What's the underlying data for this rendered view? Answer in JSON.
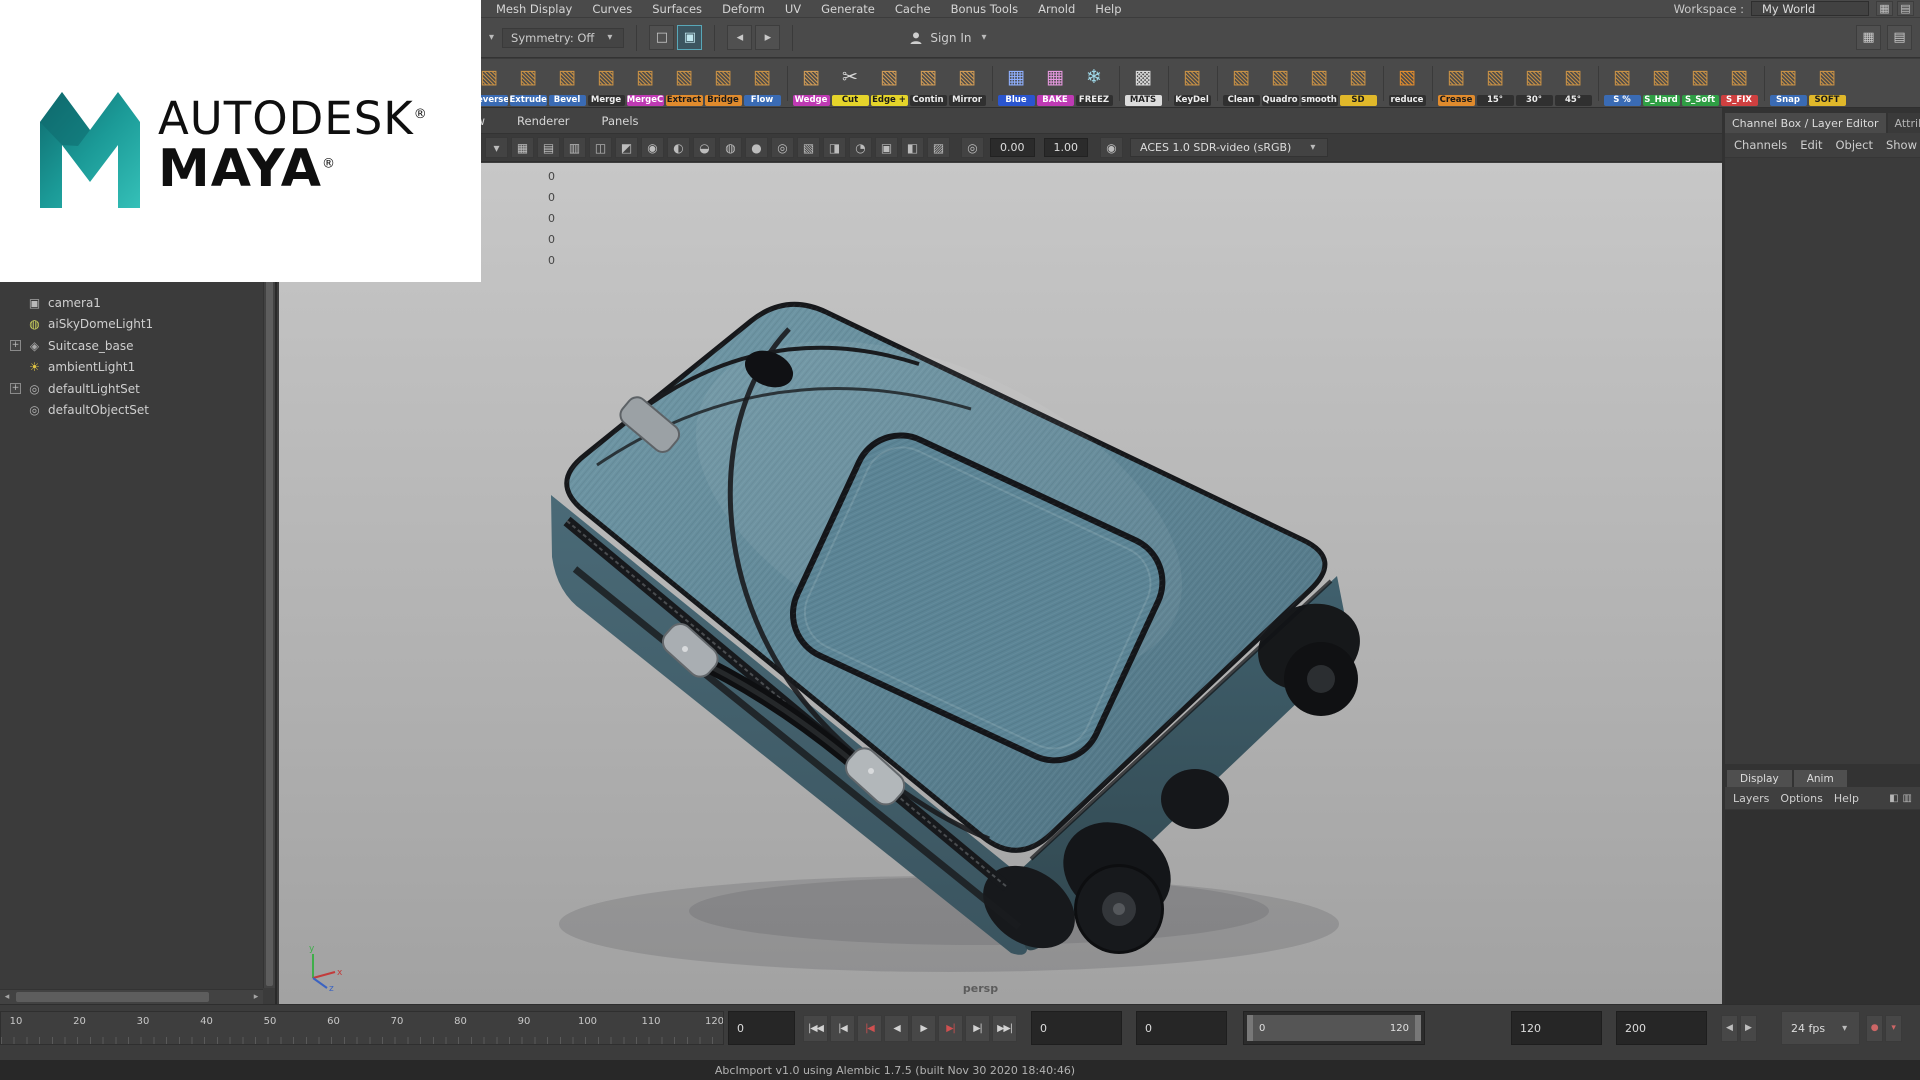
{
  "app": {
    "menu_items": [
      "Mesh Display",
      "Curves",
      "Surfaces",
      "Deform",
      "UV",
      "Generate",
      "Cache",
      "Bonus Tools",
      "Arnold",
      "Help"
    ],
    "workspace_label": "Workspace :",
    "workspace_value": "My World",
    "right_icons": [
      "▦",
      "▤"
    ]
  },
  "logo": {
    "brand": "AUTODESK",
    "product": "MAYA",
    "reg": "®"
  },
  "statusline": {
    "prefix_icon": "▾",
    "symmetry_label": "Symmetry: Off",
    "caret": "▾",
    "group_a": [
      {
        "glyph": "□",
        "active": false
      },
      {
        "glyph": "▣",
        "active": true
      }
    ],
    "group_b": [
      {
        "glyph": "◂",
        "active": false
      },
      {
        "glyph": "▸",
        "active": false
      }
    ],
    "sign_in_label": "Sign In",
    "right_icons": [
      "▦",
      "▤"
    ]
  },
  "shelf": {
    "items": [
      {
        "label": "Reverse",
        "bg": "#3a6bb4",
        "fg": "#ffffff",
        "glyph": "▧",
        "ic": "#c79045",
        "sep": false
      },
      {
        "label": "Extrude",
        "bg": "#3a6bb4",
        "fg": "#ffffff",
        "glyph": "▧",
        "ic": "#c79045",
        "sep": false
      },
      {
        "label": "Bevel",
        "bg": "#3a6bb4",
        "fg": "#ffffff",
        "glyph": "▧",
        "ic": "#c79045",
        "sep": false
      },
      {
        "label": "Merge",
        "bg": "#303030",
        "fg": "#eeeeee",
        "glyph": "▧",
        "ic": "#c79045",
        "sep": false
      },
      {
        "label": "MergeC",
        "bg": "#bf3ab4",
        "fg": "#ffffff",
        "glyph": "▧",
        "ic": "#c79045",
        "sep": false
      },
      {
        "label": "Extract",
        "bg": "#e08b2d",
        "fg": "#1a1a1a",
        "glyph": "▧",
        "ic": "#c79045",
        "sep": false
      },
      {
        "label": "Bridge",
        "bg": "#e08b2d",
        "fg": "#1a1a1a",
        "glyph": "▧",
        "ic": "#c79045",
        "sep": false
      },
      {
        "label": "Flow",
        "bg": "#3a6bb4",
        "fg": "#ffffff",
        "glyph": "▧",
        "ic": "#c79045",
        "sep": true
      },
      {
        "label": "Wedge",
        "bg": "#bf3ab4",
        "fg": "#ffffff",
        "glyph": "▧",
        "ic": "#cf9a55",
        "sep": false
      },
      {
        "label": "Cut",
        "bg": "#e5d42a",
        "fg": "#1a1a1a",
        "glyph": "✂",
        "ic": "#d8d8d8",
        "sep": false
      },
      {
        "label": "Edge +",
        "bg": "#e5d42a",
        "fg": "#1a1a1a",
        "glyph": "▧",
        "ic": "#cf9a55",
        "sep": false
      },
      {
        "label": "Contin",
        "bg": "#303030",
        "fg": "#eeeeee",
        "glyph": "▧",
        "ic": "#cf9a55",
        "sep": false
      },
      {
        "label": "Mirror",
        "bg": "#303030",
        "fg": "#eeeeee",
        "glyph": "▧",
        "ic": "#cf9a55",
        "sep": true
      },
      {
        "label": "Blue",
        "bg": "#2a55cf",
        "fg": "#ffffff",
        "glyph": "▦",
        "ic": "#8fb0ff",
        "sep": false
      },
      {
        "label": "BAKE",
        "bg": "#bf3ab4",
        "fg": "#ffffff",
        "glyph": "▦",
        "ic": "#e598de",
        "sep": false
      },
      {
        "label": "FREEZ",
        "bg": "#303030",
        "fg": "#eeeeee",
        "glyph": "❄",
        "ic": "#9fd8e8",
        "sep": true
      },
      {
        "label": "MATS",
        "bg": "#dcdcdc",
        "fg": "#222222",
        "glyph": "▩",
        "ic": "#d8d8d8",
        "sep": true
      },
      {
        "label": "KeyDel",
        "bg": "#303030",
        "fg": "#eeeeee",
        "glyph": "▧",
        "ic": "#c79045",
        "sep": true
      },
      {
        "label": "Clean",
        "bg": "#303030",
        "fg": "#eeeeee",
        "glyph": "▧",
        "ic": "#c79045",
        "sep": false
      },
      {
        "label": "Quadro",
        "bg": "#303030",
        "fg": "#eeeeee",
        "glyph": "▧",
        "ic": "#c79045",
        "sep": false
      },
      {
        "label": "smooth",
        "bg": "#303030",
        "fg": "#eeeeee",
        "glyph": "▧",
        "ic": "#c79045",
        "sep": false
      },
      {
        "label": "SD",
        "bg": "#e0b82a",
        "fg": "#1a1a1a",
        "glyph": "▧",
        "ic": "#c79045",
        "sep": true
      },
      {
        "label": "reduce",
        "bg": "#303030",
        "fg": "#eeeeee",
        "glyph": "▧",
        "ic": "#e08b2d",
        "sep": true
      },
      {
        "label": "Crease",
        "bg": "#e08b2d",
        "fg": "#1a1a1a",
        "glyph": "▧",
        "ic": "#c79045",
        "sep": false
      },
      {
        "label": "15°",
        "bg": "#303030",
        "fg": "#eeeeee",
        "glyph": "▧",
        "ic": "#c79045",
        "sep": false
      },
      {
        "label": "30°",
        "bg": "#303030",
        "fg": "#eeeeee",
        "glyph": "▧",
        "ic": "#c79045",
        "sep": false
      },
      {
        "label": "45°",
        "bg": "#303030",
        "fg": "#eeeeee",
        "glyph": "▧",
        "ic": "#c79045",
        "sep": true
      },
      {
        "label": "S %",
        "bg": "#3a6bb4",
        "fg": "#ffffff",
        "glyph": "▧",
        "ic": "#c79045",
        "sep": false
      },
      {
        "label": "S_Hard",
        "bg": "#2f9e44",
        "fg": "#ffffff",
        "glyph": "▧",
        "ic": "#c79045",
        "sep": false
      },
      {
        "label": "S_Soft",
        "bg": "#2f9e44",
        "fg": "#ffffff",
        "glyph": "▧",
        "ic": "#c79045",
        "sep": false
      },
      {
        "label": "S_FIX",
        "bg": "#cf4040",
        "fg": "#ffffff",
        "glyph": "▧",
        "ic": "#c79045",
        "sep": true
      },
      {
        "label": "Snap",
        "bg": "#3a6bb4",
        "fg": "#ffffff",
        "glyph": "▧",
        "ic": "#c79045",
        "sep": false
      },
      {
        "label": "SOFT",
        "bg": "#e0b82a",
        "fg": "#1a1a1a",
        "glyph": "▧",
        "ic": "#c79045",
        "sep": false
      }
    ]
  },
  "outliner": {
    "items": [
      {
        "label": "camera1",
        "glyph": "▣",
        "ic": "#b9b9b9",
        "expandable": false
      },
      {
        "label": "aiSkyDomeLight1",
        "glyph": "◍",
        "ic": "#cdd35e",
        "expandable": false
      },
      {
        "label": "Suitcase_base",
        "glyph": "◈",
        "ic": "#a9a9a9",
        "expandable": true
      },
      {
        "label": "ambientLight1",
        "glyph": "☀",
        "ic": "#e0c443",
        "expandable": false
      },
      {
        "label": "defaultLightSet",
        "glyph": "◎",
        "ic": "#b3b3b3",
        "expandable": true
      },
      {
        "label": "defaultObjectSet",
        "glyph": "◎",
        "ic": "#b3b3b3",
        "expandable": false
      }
    ]
  },
  "viewport": {
    "menus": [
      "Show",
      "Renderer",
      "Panels"
    ],
    "prefix_icon": "▾",
    "icons": [
      "▦",
      "▤",
      "▥",
      "◫",
      "◩",
      "◉",
      "◐",
      "◒",
      "◍",
      "●",
      "◎",
      "▧",
      "◨",
      "◔",
      "▣",
      "◧",
      "▨"
    ],
    "exposure_icon": "◎",
    "exposure": "0.00",
    "gamma": "1.00",
    "cm_icon": "◉",
    "colorspace": "ACES 1.0 SDR-video (sRGB)",
    "caret": "▾",
    "hud_values": [
      "0",
      "0",
      "0",
      "0",
      "0"
    ],
    "camera_label": "persp"
  },
  "channel_box": {
    "tab_main": "Channel Box / Layer Editor",
    "tab_alt": "Attribute Editor",
    "menus": [
      "Channels",
      "Edit",
      "Object",
      "Show"
    ],
    "layer_tabs": [
      {
        "label": "Display",
        "active": true
      },
      {
        "label": "Anim",
        "active": false
      }
    ],
    "layer_menus": [
      "Layers",
      "Options",
      "Help"
    ],
    "layer_icons": [
      "◧",
      "▥"
    ]
  },
  "timeline": {
    "ticks": [
      "10",
      "20",
      "30",
      "40",
      "50",
      "60",
      "70",
      "80",
      "90",
      "100",
      "110",
      "120"
    ],
    "current_frame": "0",
    "playback_buttons": [
      {
        "name": "go-to-start-button",
        "glyph": "|◀◀",
        "red": false
      },
      {
        "name": "step-back-frame-button",
        "glyph": "|◀",
        "red": false
      },
      {
        "name": "step-back-key-button",
        "glyph": "|◀",
        "red": true
      },
      {
        "name": "play-backwards-button",
        "glyph": "◀",
        "red": false
      },
      {
        "name": "play-forwards-button",
        "glyph": "▶",
        "red": false
      },
      {
        "name": "step-forward-key-button",
        "glyph": "▶|",
        "red": true
      },
      {
        "name": "step-forward-frame-button",
        "glyph": "▶|",
        "red": false
      },
      {
        "name": "go-to-end-button",
        "glyph": "▶▶|",
        "red": false
      }
    ],
    "anim_start": "0",
    "playback_start": "0",
    "range_start": "0",
    "range_end": "120",
    "playback_end": "120",
    "anim_end": "200",
    "stepper_icons": [
      "◀",
      "▶"
    ],
    "fps": "24 fps",
    "fps_caret": "▾",
    "right_icons": [
      "●",
      "▾"
    ]
  },
  "status_bar": {
    "message": "AbcImport v1.0 using Alembic 1.7.5 (built Nov 30 2020 18:40:46)"
  }
}
